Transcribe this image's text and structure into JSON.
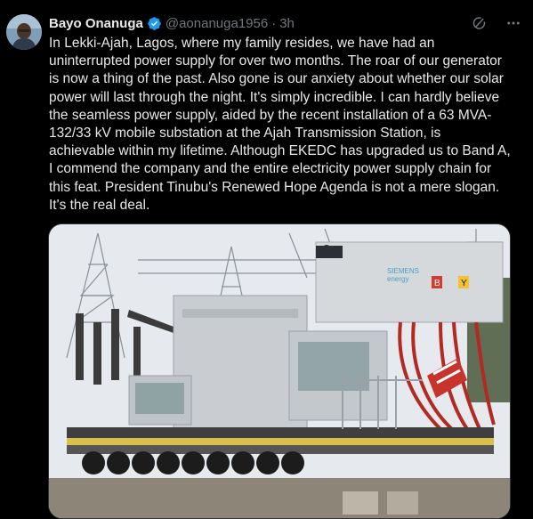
{
  "tweet": {
    "author_name": "Bayo Onanuga",
    "handle": "@aonanuga1956",
    "separator": "·",
    "time": "3h",
    "verified": true,
    "text": "In Lekki-Ajah, Lagos, where my family resides, we have had an\nuninterrupted power supply for over two months. The roar of our generator\nis now a thing of the past. Also gone is our anxiety about whether our solar\npower will last through the night. It's simply incredible. I can hardly believe\nthe seamless power supply, aided by the recent installation of a 63 MVA-\n132/33 kV mobile substation at the Ajah Transmission Station, is\nachievable within my lifetime. Although EKEDC has upgraded us to Band A,\nI commend the company and the entire electricity power supply chain for\nthis feat. President Tinubu's Renewed Hope Agenda is not a mere slogan.\nIt's the real deal.",
    "media": {
      "brand_text_line1": "SIEMENS",
      "brand_text_line2": "energy",
      "phase_label_b": "B",
      "phase_label_y": "Y"
    }
  },
  "icons": {
    "verified": "verified-badge-icon",
    "grok": "grok-icon",
    "more": "more-options-icon"
  },
  "colors": {
    "background": "#000000",
    "text": "#e7e9ea",
    "muted": "#71767b",
    "verified_blue": "#1d9bf0"
  }
}
